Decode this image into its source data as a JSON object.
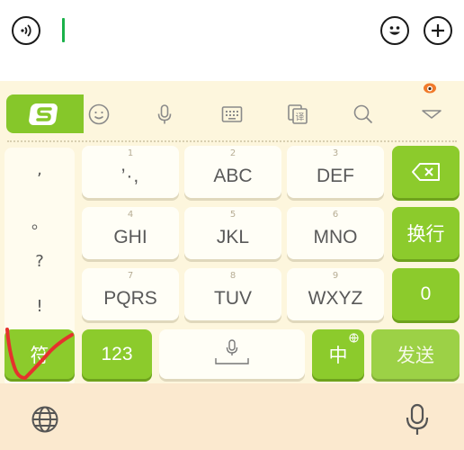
{
  "input_bar": {
    "icons": [
      "voice-wave-icon",
      "emoji-icon",
      "add-icon"
    ],
    "cursor_color": "#1bb24a"
  },
  "toolbar": {
    "icons": [
      "sogou-logo-icon",
      "smiley-icon",
      "microphone-icon",
      "keyboard-icon",
      "translate-icon",
      "search-icon",
      "collapse-arrow-icon"
    ],
    "translate_glyph": "译",
    "accent": "#86c72a"
  },
  "symbols": [
    ",",
    "。",
    "?",
    "!"
  ],
  "keys": [
    {
      "num": "1",
      "label": "’·,"
    },
    {
      "num": "2",
      "label": "ABC"
    },
    {
      "num": "3",
      "label": "DEF"
    },
    {
      "num": "4",
      "label": "GHI"
    },
    {
      "num": "5",
      "label": "JKL"
    },
    {
      "num": "6",
      "label": "MNO"
    },
    {
      "num": "7",
      "label": "PQRS"
    },
    {
      "num": "8",
      "label": "TUV"
    },
    {
      "num": "9",
      "label": "WXYZ"
    }
  ],
  "right_keys": {
    "newline": "换行",
    "zero": "0"
  },
  "bottom_row": {
    "symbol": "符",
    "num_mode": "123",
    "lang": "中",
    "send": "发送"
  },
  "footer_icons": [
    "globe-icon",
    "microphone-icon"
  ],
  "annotation_color": "#e5322d"
}
